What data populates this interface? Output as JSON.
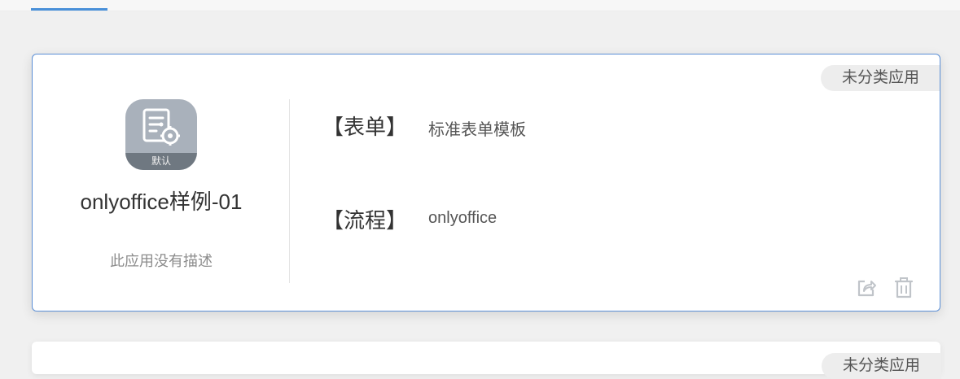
{
  "app": {
    "name": "onlyoffice样例-01",
    "description": "此应用没有描述",
    "icon": "workflow-settings-icon",
    "icon_badge": "默认",
    "icon_color": "#a9b1bb"
  },
  "category": {
    "label": "未分类应用"
  },
  "details": {
    "form": {
      "label": "【表单】",
      "value": "标准表单模板"
    },
    "process": {
      "label": "【流程】",
      "value": "onlyoffice"
    }
  },
  "actions": [
    {
      "name": "share",
      "icon": "share-icon"
    },
    {
      "name": "delete",
      "icon": "trash-icon"
    }
  ],
  "next_card": {
    "category_label": "未分类应用"
  },
  "colors": {
    "accent": "#4a90d9",
    "card_border": "#5b8fd6",
    "icon_gray": "#c0c4c9"
  }
}
